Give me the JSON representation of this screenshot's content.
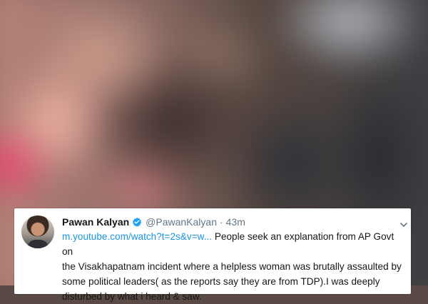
{
  "tweet": {
    "display_name": "Pawan Kalyan",
    "handle": "@PawanKalyan",
    "separator": "·",
    "time": "43m",
    "link_text": "m.youtube.com/watch?t=2s&v=w...",
    "lines": [
      " People seek an explanation from AP Govt on",
      "the Visakhapatnam incident where a helpless woman was brutally assaulted by",
      "some political leaders( as the reports say they are from TDP).I was deeply",
      "disturbed by what i heard & saw."
    ],
    "icons": {
      "verified": "verified-badge-icon",
      "menu": "chevron-down-icon"
    },
    "colors": {
      "link": "#1b95e0",
      "verified": "#1da1f2",
      "secondary_text": "#657786"
    }
  }
}
